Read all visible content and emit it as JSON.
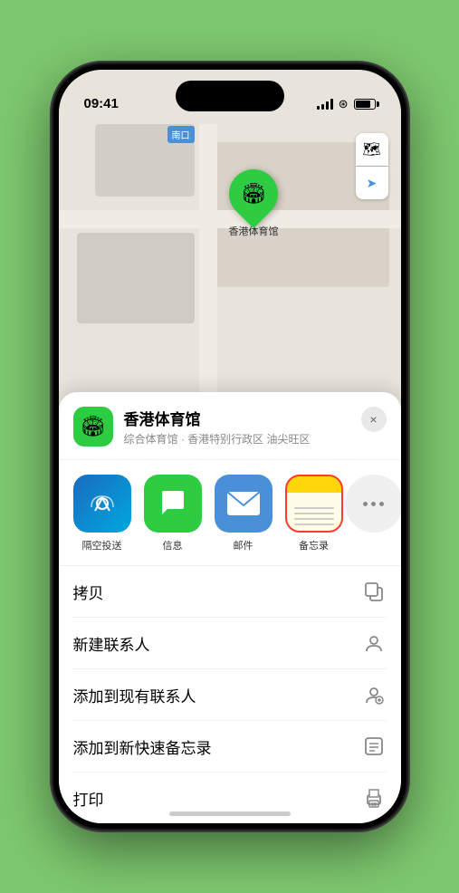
{
  "statusBar": {
    "time": "09:41",
    "locationArrow": "▶"
  },
  "map": {
    "label": "南口"
  },
  "mapControls": {
    "mapViewIcon": "🗺",
    "locationIcon": "➤"
  },
  "marker": {
    "label": "香港体育馆",
    "emoji": "🏟"
  },
  "locationHeader": {
    "name": "香港体育馆",
    "desc": "综合体育馆 · 香港特别行政区 油尖旺区",
    "closeLabel": "×",
    "iconEmoji": "🏟"
  },
  "shareApps": [
    {
      "id": "airdrop",
      "label": "隔空投送",
      "type": "airdrop"
    },
    {
      "id": "messages",
      "label": "信息",
      "type": "messages"
    },
    {
      "id": "mail",
      "label": "邮件",
      "type": "mail"
    },
    {
      "id": "notes",
      "label": "备忘录",
      "type": "notes",
      "selected": true
    }
  ],
  "actions": [
    {
      "id": "copy",
      "label": "拷贝",
      "icon": "⿻"
    },
    {
      "id": "new-contact",
      "label": "新建联系人",
      "icon": "👤"
    },
    {
      "id": "add-existing",
      "label": "添加到现有联系人",
      "icon": "👤"
    },
    {
      "id": "quick-note",
      "label": "添加到新快速备忘录",
      "icon": "📝"
    },
    {
      "id": "print",
      "label": "打印",
      "icon": "🖨"
    }
  ]
}
